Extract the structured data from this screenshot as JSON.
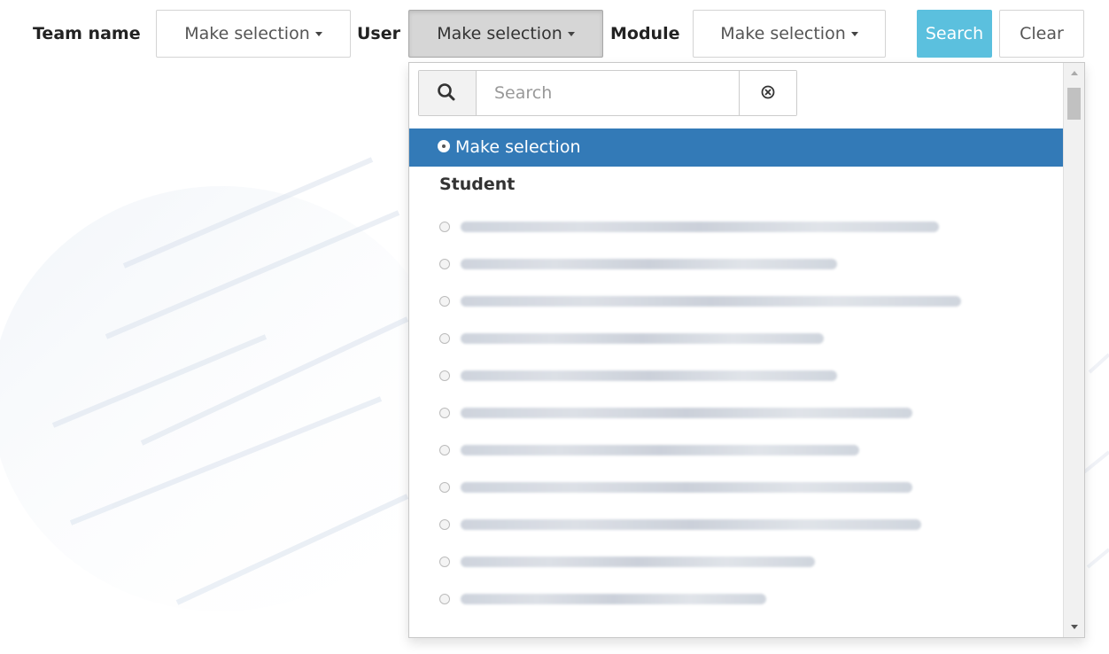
{
  "filters": {
    "team_label": "Team name",
    "team_value": "Make selection",
    "user_label": "User",
    "user_value": "Make selection",
    "module_label": "Module",
    "module_value": "Make selection"
  },
  "buttons": {
    "search_label": "Search",
    "clear_label": "Clear"
  },
  "dropdown": {
    "search_placeholder": "Search",
    "selected_option": "Make selection",
    "group_label": "Student",
    "options_text": [
      "",
      "",
      "",
      "",
      "",
      "",
      "",
      "",
      "",
      "",
      ""
    ]
  },
  "colors": {
    "search_button": "#5bc0de",
    "selected_row": "#337ab7"
  },
  "icons": [
    "chevron-down-icon",
    "magnifier-icon",
    "clear-circle-icon",
    "scroll-up-icon",
    "scroll-down-icon"
  ]
}
